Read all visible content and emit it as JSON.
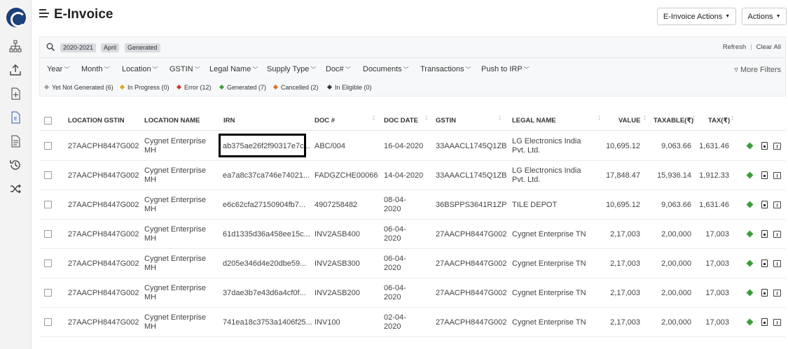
{
  "header": {
    "title": "E-Invoice",
    "einvoice_actions_label": "E-Invoice Actions",
    "actions_label": "Actions"
  },
  "search": {
    "chips": [
      "2020-2021",
      "April",
      "Generated"
    ],
    "refresh_label": "Refresh",
    "clear_all_label": "Clear All"
  },
  "filters": [
    "Year",
    "Month",
    "Location",
    "GSTIN",
    "Legal Name",
    "Supply Type",
    "Doc#",
    "Documents",
    "Transactions",
    "Push to IRP"
  ],
  "more_filters_label": "More Filters",
  "status_legend": [
    {
      "label": "Yet Not Generated (6)",
      "color": "#a0a0a0"
    },
    {
      "label": "In Progress (0)",
      "color": "#e0a020"
    },
    {
      "label": "Error (12)",
      "color": "#d03a2a"
    },
    {
      "label": "Generated (7)",
      "color": "#3a9e3a"
    },
    {
      "label": "Cancelled (2)",
      "color": "#e06a20"
    },
    {
      "label": "In Eligible (0)",
      "color": "#333333"
    }
  ],
  "table": {
    "columns": [
      "LOCATION GSTIN",
      "LOCATION NAME",
      "IRN",
      "DOC #",
      "DOC DATE",
      "GSTIN",
      "LEGAL NAME",
      "VALUE",
      "TAXABLE(₹)",
      "TAX(₹)"
    ],
    "rows": [
      {
        "loc_gstin": "27AACPH8447G002",
        "loc_name": "Cygnet Enterprise MH",
        "irn": "ab375ae26f2f90317e7c...",
        "doc": "ABC/004",
        "date": "16-04-2020",
        "gstin": "33AAACL1745Q1ZB",
        "legal": "LG Electronics India Pvt. Ltd.",
        "value": "10,695.12",
        "taxable": "9,063.66",
        "tax": "1,631.46"
      },
      {
        "loc_gstin": "27AACPH8447G002",
        "loc_name": "Cygnet Enterprise MH",
        "irn": "ea7a8c37ca746e74021...",
        "doc": "FADGZCHE00066",
        "date": "14-04-2020",
        "gstin": "33AAACL1745Q1ZB",
        "legal": "LG Electronics India Pvt. Ltd.",
        "value": "17,848.47",
        "taxable": "15,936.14",
        "tax": "1,912.33"
      },
      {
        "loc_gstin": "27AACPH8447G002",
        "loc_name": "Cygnet Enterprise MH",
        "irn": "e6c62cfa27150904fb7...",
        "doc": "4907258482",
        "date": "08-04-2020",
        "gstin": "36BSPPS3641R1ZP",
        "legal": "TILE DEPOT",
        "value": "10,695.12",
        "taxable": "9,063.66",
        "tax": "1,631.46"
      },
      {
        "loc_gstin": "27AACPH8447G002",
        "loc_name": "Cygnet Enterprise MH",
        "irn": "61d1335d36a458ee15c...",
        "doc": "INV2ASB400",
        "date": "06-04-2020",
        "gstin": "27AACPH8447G002",
        "legal": "Cygnet Enterprise TN",
        "value": "2,17,003",
        "taxable": "2,00,000",
        "tax": "17,003"
      },
      {
        "loc_gstin": "27AACPH8447G002",
        "loc_name": "Cygnet Enterprise MH",
        "irn": "d205e346d4e20dbe59...",
        "doc": "INV2ASB300",
        "date": "06-04-2020",
        "gstin": "27AACPH8447G002",
        "legal": "Cygnet Enterprise TN",
        "value": "2,17,003",
        "taxable": "2,00,000",
        "tax": "17,003"
      },
      {
        "loc_gstin": "27AACPH8447G002",
        "loc_name": "Cygnet Enterprise MH",
        "irn": "37dae3b7e43d6a4cf0f...",
        "doc": "INV2ASB200",
        "date": "06-04-2020",
        "gstin": "27AACPH8447G002",
        "legal": "Cygnet Enterprise TN",
        "value": "2,17,003",
        "taxable": "2,00,000",
        "tax": "17,003"
      },
      {
        "loc_gstin": "27AACPH8447G002",
        "loc_name": "Cygnet Enterprise MH",
        "irn": "741ea18c3753a1406f25...",
        "doc": "INV100",
        "date": "02-04-2020",
        "gstin": "27AACPH8447G002",
        "legal": "Cygnet Enterprise TN",
        "value": "2,17,003",
        "taxable": "2,00,000",
        "tax": "17,003"
      }
    ]
  }
}
